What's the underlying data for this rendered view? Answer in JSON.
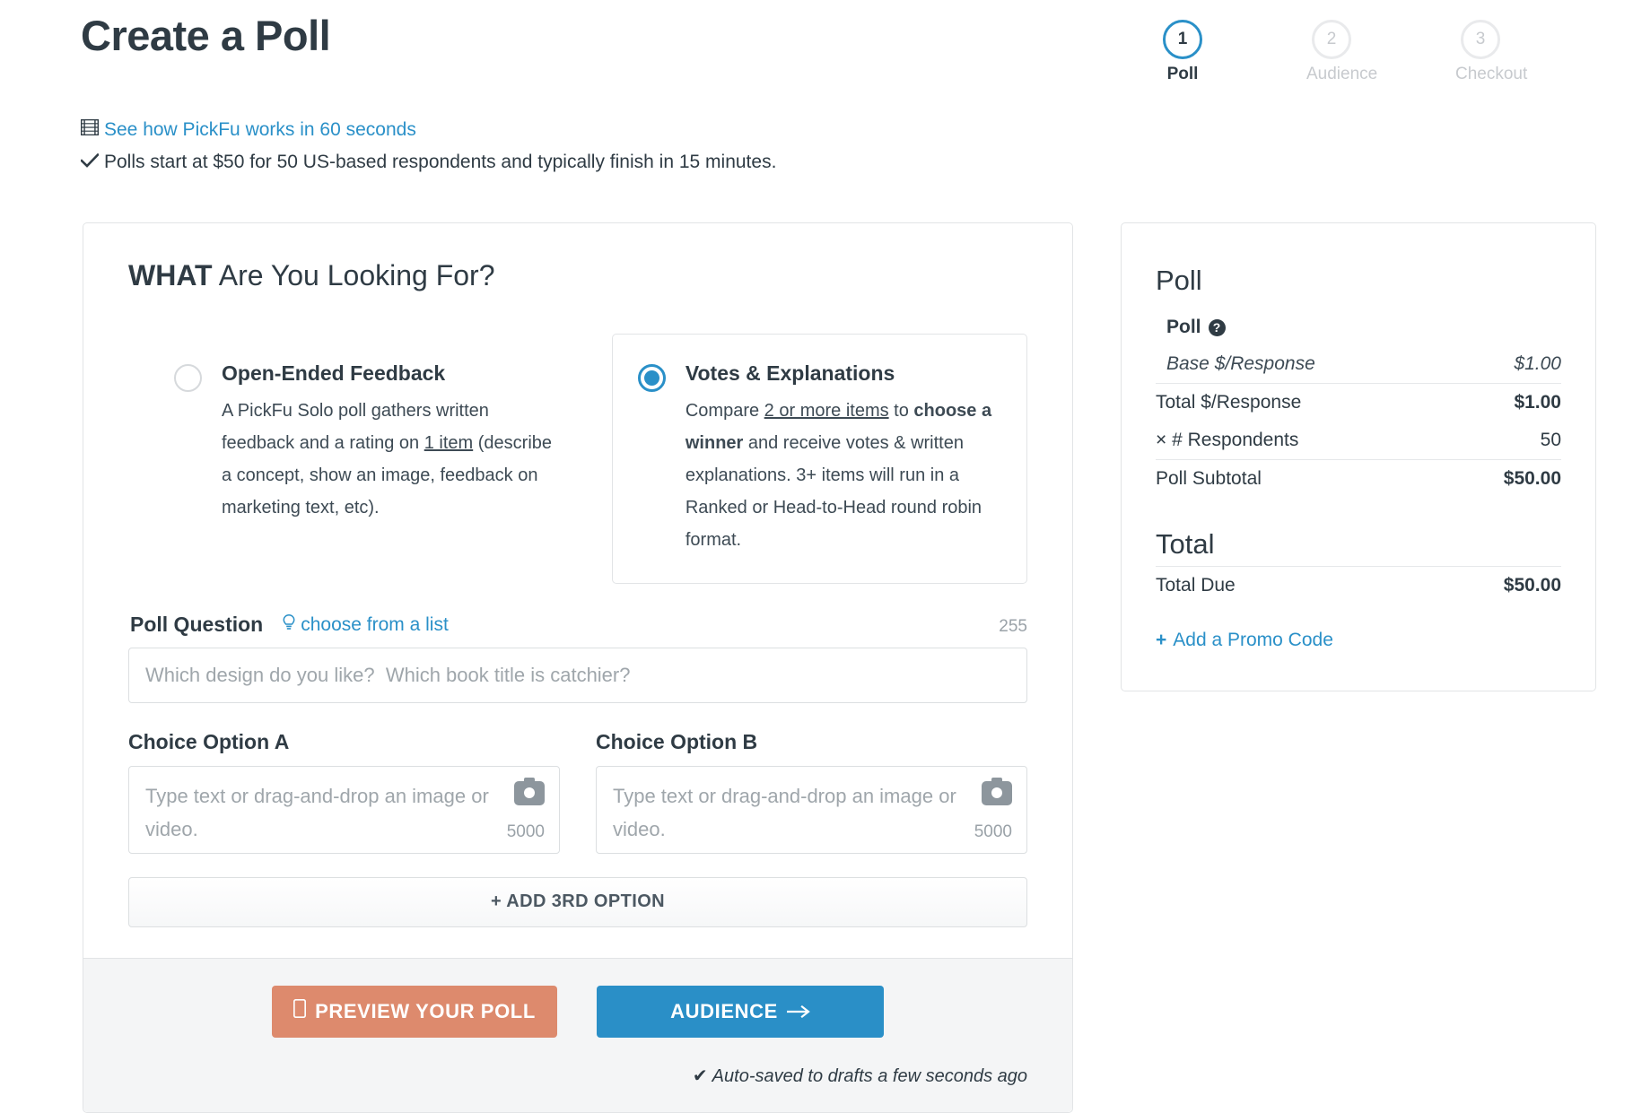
{
  "header": {
    "title": "Create a Poll",
    "video_link": "See how PickFu works in 60 seconds",
    "video_icon": "film-icon",
    "check_icon": "check-icon",
    "tagline": "Polls start at $50 for 50 US-based respondents and typically finish in 15 minutes."
  },
  "steps": [
    {
      "number": "1",
      "label": "Poll",
      "active": true
    },
    {
      "number": "2",
      "label": "Audience",
      "active": false
    },
    {
      "number": "3",
      "label": "Checkout",
      "active": false
    }
  ],
  "main": {
    "section_title_bold": "WHAT",
    "section_title_rest": " Are You Looking For?",
    "choices": [
      {
        "title": "Open-Ended Feedback",
        "selected": false,
        "desc_parts": [
          {
            "text": "A PickFu Solo poll gathers written feedback and a rating on ",
            "style": "normal"
          },
          {
            "text": "1 item",
            "style": "underline"
          },
          {
            "text": " (describe a concept, show an image, feedback on marketing text, etc).",
            "style": "normal"
          }
        ]
      },
      {
        "title": "Votes & Explanations",
        "selected": true,
        "desc_parts": [
          {
            "text": "Compare ",
            "style": "normal"
          },
          {
            "text": "2 or more items",
            "style": "underline"
          },
          {
            "text": " to ",
            "style": "normal"
          },
          {
            "text": "choose a winner",
            "style": "bold"
          },
          {
            "text": " and receive votes & written explanations. 3+ items will run in a Ranked or Head-to-Head round robin format.",
            "style": "normal"
          }
        ]
      }
    ],
    "poll_question": {
      "label": "Poll Question",
      "choose_link": "choose from a list",
      "choose_link_icon": "lightbulb-icon",
      "char_count": "255",
      "value": "",
      "placeholder": "Which design do you like?  Which book title is catchier?"
    },
    "options": [
      {
        "label": "Choice Option A",
        "value": "",
        "placeholder": "Type text or drag-and-drop an image or video.",
        "char_count": "5000",
        "camera_icon": "camera-icon"
      },
      {
        "label": "Choice Option B",
        "value": "",
        "placeholder": "Type text or drag-and-drop an image or video.",
        "char_count": "5000",
        "camera_icon": "camera-icon"
      }
    ],
    "add_option_label": "+ ADD 3RD OPTION",
    "footer": {
      "preview_label": "PREVIEW YOUR POLL",
      "preview_icon": "device-icon",
      "audience_label": "AUDIENCE",
      "audience_icon": "arrow-right-icon",
      "autosave_text": "Auto-saved to drafts a few seconds ago",
      "autosave_icon": "check-icon"
    }
  },
  "summary": {
    "heading": "Poll",
    "sub_heading": "Poll",
    "sub_help_icon": "question-mark-icon",
    "rows": [
      {
        "label": "Base $/Response",
        "value": "$1.00",
        "style": "italic-indent"
      },
      {
        "label": "Total $/Response",
        "value": "$1.00",
        "style": "bold-sep"
      },
      {
        "label": "× # Respondents",
        "value": "50",
        "style": "bold-label"
      },
      {
        "label": "Poll Subtotal",
        "value": "$50.00",
        "style": "bold-sep"
      }
    ],
    "total_heading": "Total",
    "total_row": {
      "label": "Total Due",
      "value": "$50.00"
    },
    "promo_label": "Add a Promo Code",
    "promo_plus": "+"
  },
  "colors": {
    "accent_blue": "#2a90c8",
    "button_blue": "#2a8fc7",
    "preview_salmon": "#dd8a6d",
    "text_dark": "#2f3b44",
    "muted": "#9aa2a8"
  }
}
